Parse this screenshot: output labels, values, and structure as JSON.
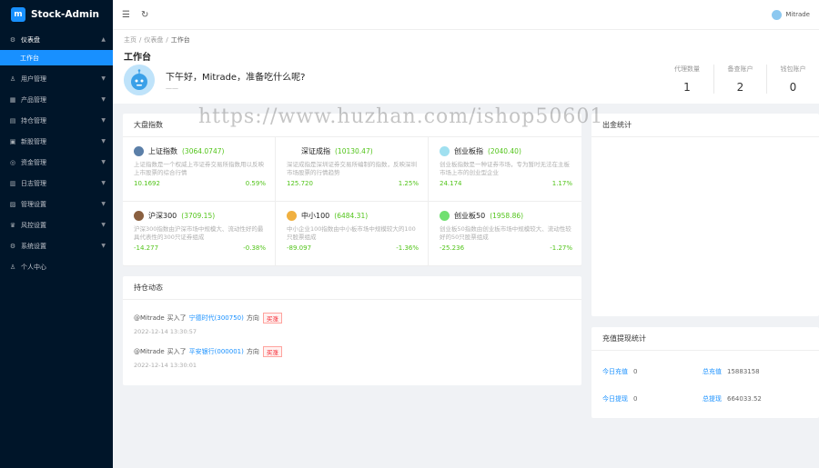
{
  "app": {
    "name": "Stock-Admin",
    "logo_letter": "m"
  },
  "sidebar": {
    "items": [
      {
        "icon": "dashboard-icon",
        "glyph": "⚙",
        "label": "仪表盘",
        "open": true,
        "sub": [
          {
            "label": "工作台",
            "active": true
          }
        ]
      },
      {
        "icon": "user-icon",
        "glyph": "♙",
        "label": "用户管理"
      },
      {
        "icon": "product-icon",
        "glyph": "▦",
        "label": "产品管理"
      },
      {
        "icon": "position-icon",
        "glyph": "▤",
        "label": "持仓管理"
      },
      {
        "icon": "news-icon",
        "glyph": "▣",
        "label": "新股管理"
      },
      {
        "icon": "fund-icon",
        "glyph": "◎",
        "label": "资金管理"
      },
      {
        "icon": "log-icon",
        "glyph": "▥",
        "label": "日志管理"
      },
      {
        "icon": "manage-icon",
        "glyph": "▨",
        "label": "管理设置"
      },
      {
        "icon": "risk-icon",
        "glyph": "♛",
        "label": "风控设置"
      },
      {
        "icon": "settings-icon",
        "glyph": "⚙",
        "label": "系统设置"
      },
      {
        "icon": "person-icon",
        "glyph": "♙",
        "label": "个人中心"
      }
    ]
  },
  "header": {
    "user": "Mitrade"
  },
  "breadcrumb": [
    "主页",
    "仪表盘",
    "工作台"
  ],
  "page": {
    "title": "工作台",
    "greeting": "下午好，Mitrade，准备吃什么呢?",
    "greeting_sub": "——"
  },
  "stats": [
    {
      "label": "代理数量",
      "value": "1"
    },
    {
      "label": "备查账户",
      "value": "2"
    },
    {
      "label": "钱包账户",
      "value": "0"
    }
  ],
  "market": {
    "title": "大盘指数",
    "indices": [
      {
        "name": "上证指数",
        "value": "(3064.0747)",
        "color": "#5b7fa8",
        "desc": "上证指数是一个权威上市证券交易所指数用以反映上市股票的综合行情",
        "change": "10.1692",
        "pct": "0.59%"
      },
      {
        "name": "深证成指",
        "value": "(10130.47)",
        "color": "#ffffff",
        "desc": "深证成指是深圳证券交易所编制的指数，反映深圳市场股票的行情趋势",
        "change": "125.720",
        "pct": "1.25%"
      },
      {
        "name": "创业板指",
        "value": "(2040.40)",
        "color": "#a0e0f0",
        "desc": "创业板指数是一种证券市场，专为暂时无法在主板市场上市的创业型企业",
        "change": "24.174",
        "pct": "1.17%"
      },
      {
        "name": "沪深300",
        "value": "(3709.15)",
        "color": "#8a6040",
        "desc": "沪深300指数由沪深市场中规模大、流动性好的最具代表性的300只证券组成",
        "change": "-14.277",
        "pct": "-0.38%"
      },
      {
        "name": "中小100",
        "value": "(6484.31)",
        "color": "#f0b040",
        "desc": "中小企业100指数由中小板市场中规模较大的100只股票组成",
        "change": "-89.097",
        "pct": "-1.36%"
      },
      {
        "name": "创业板50",
        "value": "(1958.86)",
        "color": "#70e070",
        "desc": "创业板50指数由创业板市场中规模较大、流动性较好的50只股票组成",
        "change": "-25.236",
        "pct": "-1.27%"
      }
    ]
  },
  "trades": {
    "title": "持仓动态",
    "items": [
      {
        "user": "@Mitrade",
        "action": "买入了",
        "stock": "宁德时代(300750)",
        "dir": "方向",
        "tag": "买涨",
        "time": "2022-12-14 13:30:57"
      },
      {
        "user": "@Mitrade",
        "action": "买入了",
        "stock": "平安银行(000001)",
        "dir": "方向",
        "tag": "买涨",
        "time": "2022-12-14 13:30:01"
      }
    ]
  },
  "right": {
    "stats_title": "出金统计"
  },
  "withdraw": {
    "title": "充值提现统计",
    "items": [
      {
        "label": "今日充值",
        "value": "0"
      },
      {
        "label": "总充值",
        "value": "15883158"
      },
      {
        "label": "今日提现",
        "value": "0"
      },
      {
        "label": "总提现",
        "value": "664033.52"
      }
    ]
  },
  "watermark": "https://www.huzhan.com/ishop50601"
}
